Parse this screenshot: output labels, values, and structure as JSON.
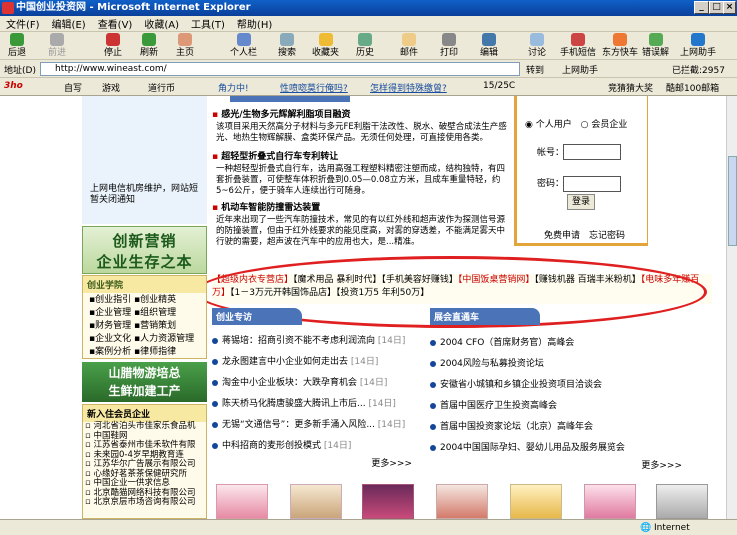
{
  "window": {
    "title": "中国创业投资网 - Microsoft Internet Explorer"
  },
  "menu": [
    "文件(F)",
    "编辑(E)",
    "查看(V)",
    "收藏(A)",
    "工具(T)",
    "帮助(H)"
  ],
  "toolbar": [
    "后退",
    "前进",
    "停止",
    "刷新",
    "主页",
    "个人栏",
    "搜索",
    "收藏夹",
    "历史",
    "邮件",
    "打印",
    "编辑",
    "讨论",
    "手机短信",
    "东方快车",
    "错误解",
    "上网助手"
  ],
  "address": {
    "label": "地址(D)",
    "url": "http://www.wineast.com/",
    "go": "转到",
    "helper": "上网助手",
    "blocked": "已拦截:2957"
  },
  "links": {
    "items": [
      "自写",
      "游戏",
      "道行币",
      "角力中!",
      "性喷唿莫行俺吗?",
      "怎样得到特殊缴曾?"
    ],
    "weather": "15/25C",
    "right": [
      "竞猜猜大奖",
      "酷邮100邮箱"
    ]
  },
  "ads": {
    "aids_left": "上网电信机房维护，网站短暂关闭通知",
    "banner_1": "创新营销",
    "banner_2": "企业生存之本"
  },
  "news": [
    {
      "title": "感光/生物多元辉解利脂项目融资",
      "body": "该项目采用天然高分子材料与多元FE利脂干法改性、脱水、破壁合成法生产感光、地热生物辉解膜、盒类环保产品。无须任何处理，可直接使用各类。"
    },
    {
      "title": "超轻型折叠式自行车专利转让",
      "body": "一种超轻型折叠式自行车，选用高强工程塑料精密注塑而成，结构独特，有四套折叠装置，可使整车体积折叠到0.05—0.08立方米，且成车重量特轻，约5~6公斤，便于骑车人连续出行可随身。"
    },
    {
      "title": "机动车智能防撞雷达装置",
      "body": "近年来出现了一些汽车防撞技术，常见的有以红外线和超声波作为探测信号源的防撞装置，但由于红外线要求的能见度高，对雾的穿透差，不能满足雾天中行驶的需要，超声波在汽车中的应用也大，是...精准。"
    }
  ],
  "login": {
    "opt_personal": "个人用户",
    "opt_company": "会员企业",
    "account": "帐号：",
    "password": "密码：",
    "login_btn": "登录",
    "register": "免费申请",
    "forgot": "忘记密码"
  },
  "ticker": [
    "【超级内衣专营店】",
    "【魔术用品 暴利时代】",
    "【手机美容好赚钱】",
    "【中国饭桌营销网】",
    "【赚钱机器 百瑞丰米粉机】",
    "【电味多年赚百万】",
    "【1－3万元开韩国饰品店】",
    "【投资1万5 年利50万】"
  ],
  "left_section": {
    "title": "创业学院",
    "items": [
      [
        "创业指引",
        "创业精英"
      ],
      [
        "企业管理",
        "组织管理"
      ],
      [
        "财务管理",
        "营销策划"
      ],
      [
        "企业文化",
        "人力资源管理"
      ],
      [
        "案例分析",
        "律师指律"
      ]
    ]
  },
  "banner_left": {
    "l1": "山腊物游培总",
    "l2": "生鲜加建工产"
  },
  "members": {
    "title": "新入住会员企业",
    "items": [
      "河北省泊头市佳家乐食品机",
      "中国鞋网",
      "江苏省泰州市佳禾软件有限",
      "未来园0-4岁早期教育连",
      "江苏华尔广告展示有限公司",
      "心缘好茗茶茶保健研究所",
      "中国企业一供求信息",
      "北京酷猫网络科技有限公司",
      "北京京层市场咨询有限公司"
    ]
  },
  "startup": {
    "title": "创业专访",
    "items": [
      {
        "t": "蒋锡培：招商引资不能不考虑利润流向",
        "d": "[14日]"
      },
      {
        "t": "龙永图建言中小企业如何走出去",
        "d": "[14日]"
      },
      {
        "t": "淘金中小企业板块：大跌孕育机会",
        "d": "[14日]"
      },
      {
        "t": "陈天桥马化腾唐骏盛大腾讯上市后...",
        "d": "[14日]"
      },
      {
        "t": "无锡“文通信号”：更多新手涌入风险...",
        "d": "[14日]"
      },
      {
        "t": "中科招商的麦形创投模式",
        "d": "[14日]"
      }
    ],
    "more": "更多>>>"
  },
  "expo": {
    "title": "展会直通车",
    "items": [
      "2004 CFO（首席财务官）高峰会",
      "2004风险与私募投资论坛",
      "安徽省小城镇和乡镇企业投资项目洽谈会",
      "首届中国医疗卫生投资高峰会",
      "首届中国投资家论坛（北京）高峰年会",
      "2004中国国际孕妇、婴幼儿用品及服务展览会"
    ],
    "more": "更多>>>"
  },
  "status": {
    "left": "",
    "zone": "Internet"
  }
}
